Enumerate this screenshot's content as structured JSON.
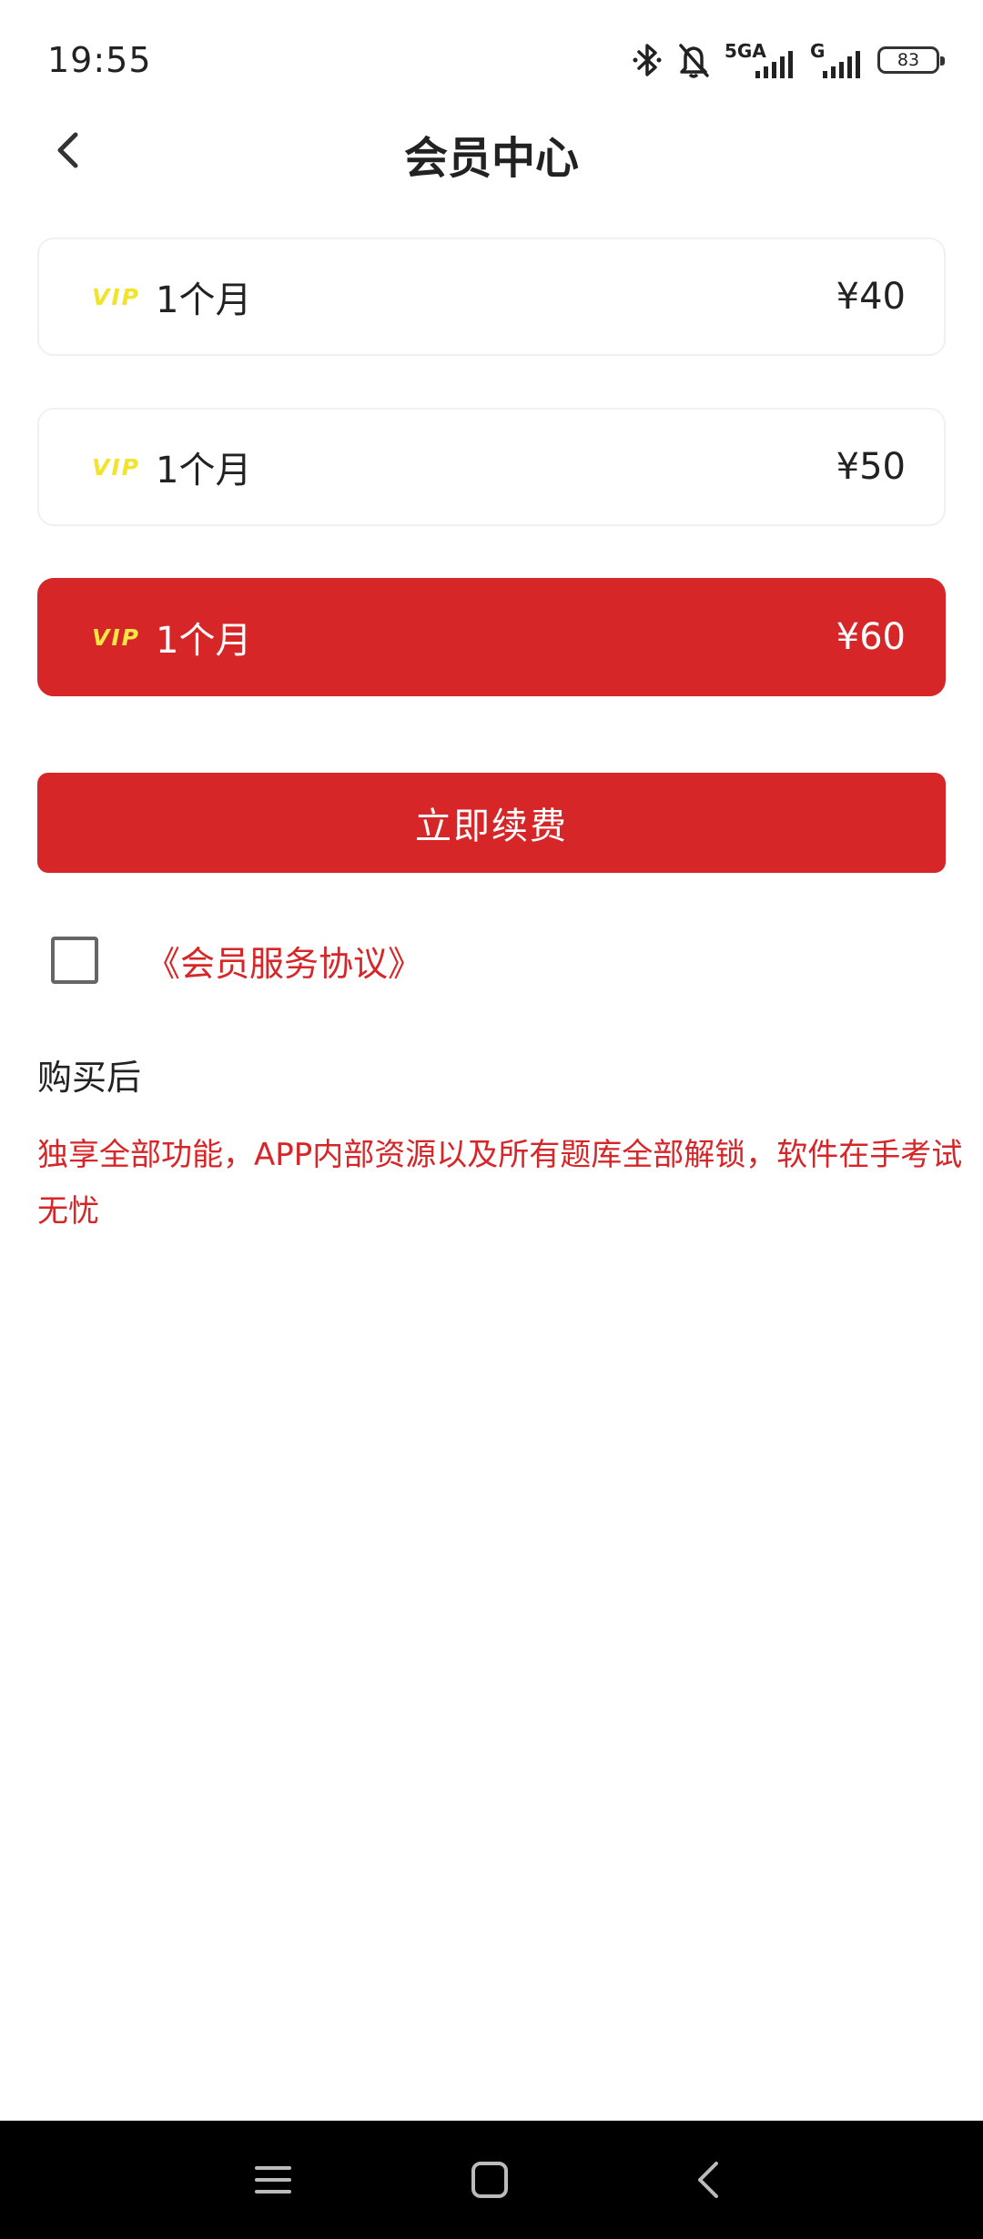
{
  "status_bar": {
    "time": "19:55",
    "network_primary": "5GA",
    "network_secondary": "G",
    "battery": "83",
    "icons": [
      "bluetooth-icon",
      "mute-bell-icon",
      "signal-icon",
      "battery-icon"
    ]
  },
  "header": {
    "title": "会员中心",
    "back_icon": "chevron-left-icon"
  },
  "plans": [
    {
      "badge": "VIP",
      "duration": "1个月",
      "price": "¥40",
      "selected": false
    },
    {
      "badge": "VIP",
      "duration": "1个月",
      "price": "¥50",
      "selected": false
    },
    {
      "badge": "VIP",
      "duration": "1个月",
      "price": "¥60",
      "selected": true
    }
  ],
  "renew_button": {
    "label": "立即续费"
  },
  "agreement": {
    "checked": false,
    "link_text": "《会员服务协议》"
  },
  "after_purchase": {
    "heading": "购买后",
    "description": "独享全部功能，APP内部资源以及所有题库全部解锁，软件在手考试无忧"
  },
  "colors": {
    "accent": "#d72628",
    "vip_badge": "#f2e32b",
    "nav_bar": "#000000"
  },
  "nav_bar": {
    "icons": [
      "menu-icon",
      "home-icon",
      "back-icon"
    ]
  }
}
